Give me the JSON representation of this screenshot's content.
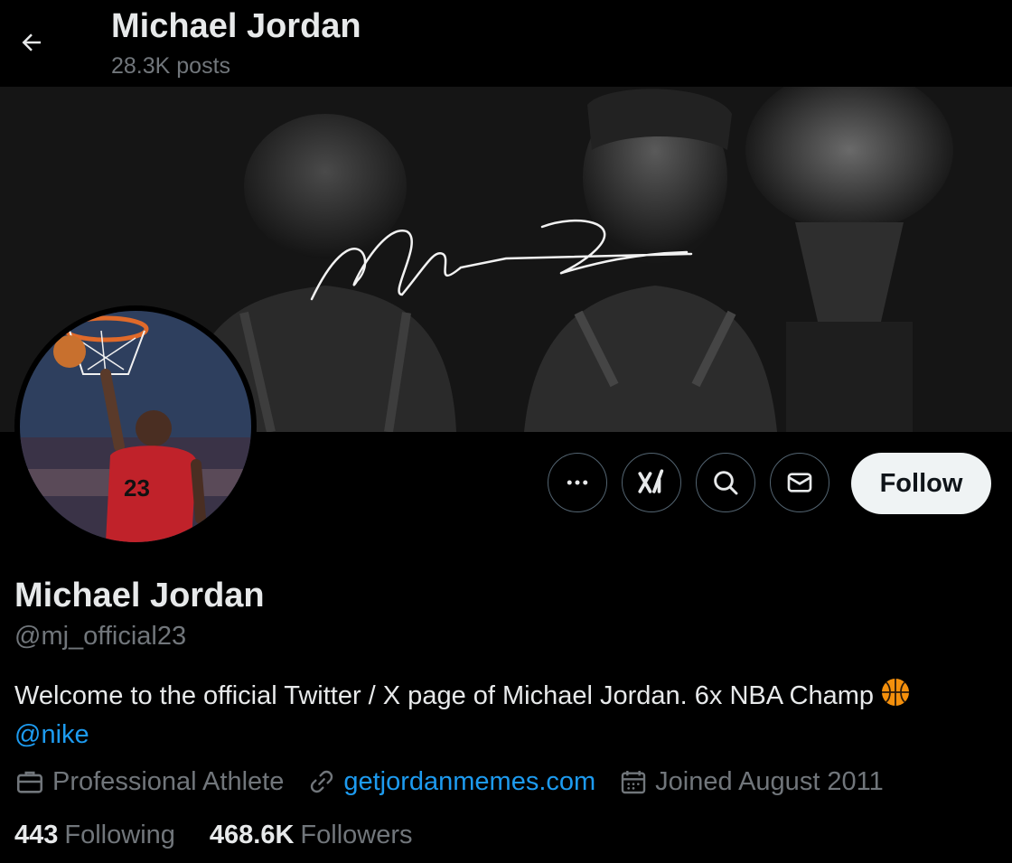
{
  "header": {
    "title": "Michael Jordan",
    "posts": "28.3K posts"
  },
  "banner": {
    "description_icon": "signature-banner-image"
  },
  "actions": {
    "more_icon": "more-icon",
    "grok_icon": "grok-icon",
    "search_icon": "search-icon",
    "message_icon": "message-icon",
    "follow_label": "Follow"
  },
  "profile": {
    "name": "Michael Jordan",
    "handle": "@mj_official23",
    "bio_text": "Welcome to the official Twitter / X page of Michael Jordan. 6x NBA Champ",
    "bio_mention": "@nike",
    "category": "Professional Athlete",
    "website": "getjordanmemes.com",
    "joined": "Joined August 2011",
    "following_count": "443",
    "following_label": "Following",
    "followers_count": "468.6K",
    "followers_label": "Followers"
  },
  "colors": {
    "link": "#1d9bf0",
    "muted": "#71767b",
    "text": "#e7e9ea",
    "background": "#000000"
  }
}
